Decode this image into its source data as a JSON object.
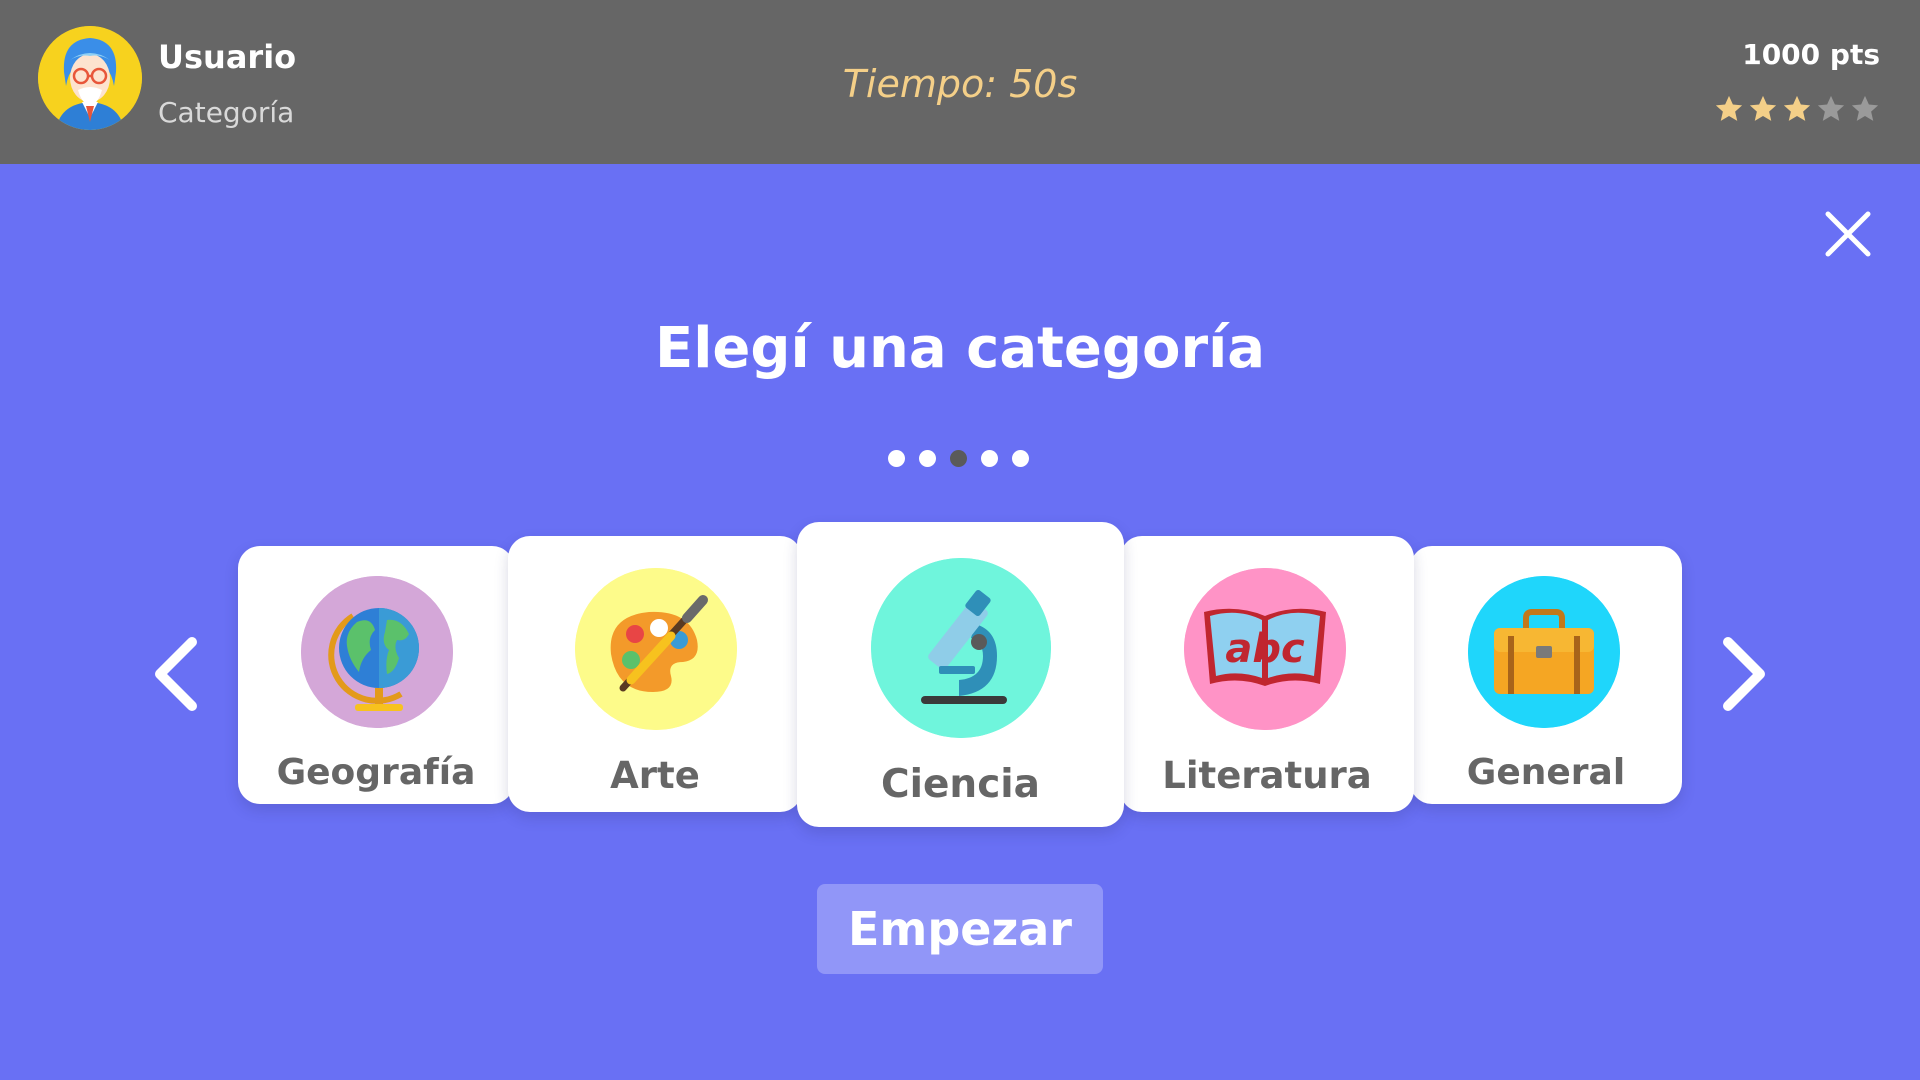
{
  "header": {
    "user_name": "Usuario",
    "user_category": "Categoría",
    "timer": "Tiempo: 50s",
    "points": "1000 pts",
    "rating": {
      "filled": 3,
      "total": 5
    }
  },
  "main": {
    "title": "Elegí una categoría",
    "pagination": {
      "count": 5,
      "active_index": 2
    },
    "categories": [
      {
        "label": "Geografía",
        "icon": "globe-icon",
        "circle_color": "#d4a7d8"
      },
      {
        "label": "Arte",
        "icon": "palette-icon",
        "circle_color": "#fdfb8a"
      },
      {
        "label": "Ciencia",
        "icon": "microscope-icon",
        "circle_color": "#6ff5dc"
      },
      {
        "label": "Literatura",
        "icon": "book-icon",
        "circle_color": "#ff93c6"
      },
      {
        "label": "General",
        "icon": "briefcase-icon",
        "circle_color": "#1fd6fb"
      }
    ],
    "book_text": "abc",
    "start_label": "Empezar"
  },
  "colors": {
    "background": "#6970f4",
    "header": "#666666",
    "timer": "#f4cf88",
    "star_filled": "#f4cf88",
    "star_empty": "#9a9a9a"
  }
}
